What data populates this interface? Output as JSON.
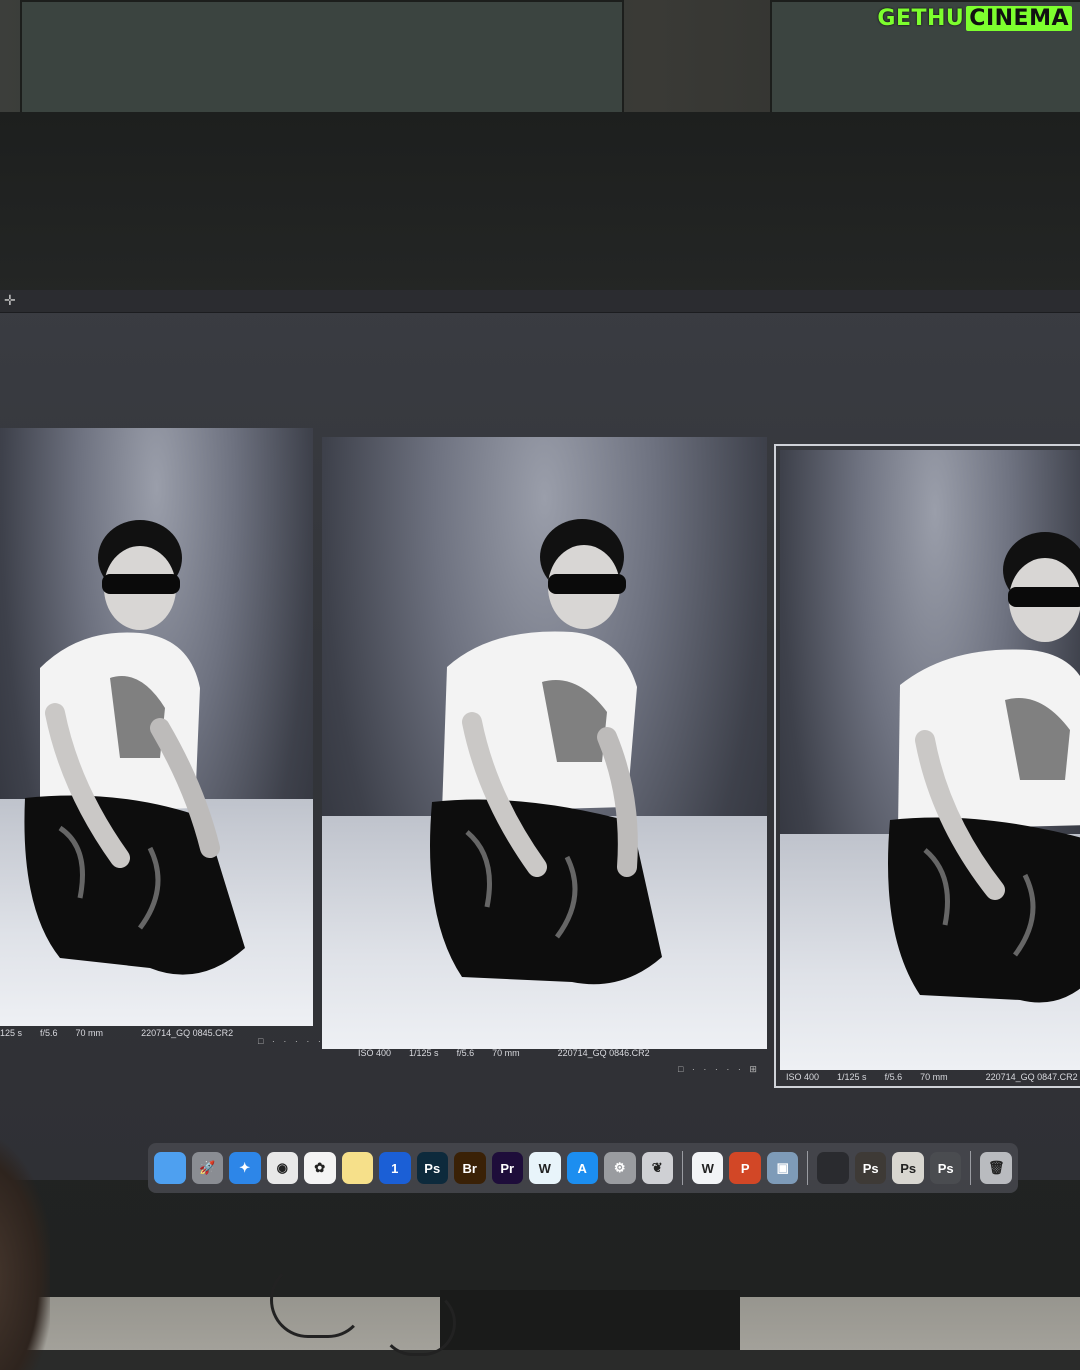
{
  "watermark": {
    "part1": "GETHU",
    "part2": "CINEMA"
  },
  "colors": {
    "watermark_green": "#7dff2e",
    "selected_frame": "#cfd2d8"
  },
  "toolbar": {
    "icon": "crosshair-icon"
  },
  "thumbnails": [
    {
      "iso": "",
      "shutter": "125 s",
      "aperture": "f/5.6",
      "focal": "70 mm",
      "filename": "220714_GQ 0845.CR2",
      "selected": false
    },
    {
      "iso": "ISO 400",
      "shutter": "1/125 s",
      "aperture": "f/5.6",
      "focal": "70 mm",
      "filename": "220714_GQ 0846.CR2",
      "selected": false
    },
    {
      "iso": "ISO 400",
      "shutter": "1/125 s",
      "aperture": "f/5.6",
      "focal": "70 mm",
      "filename": "220714_GQ 0847.CR2",
      "selected": true
    }
  ],
  "rating_dots": "□ · · · · · ⊞",
  "dock": {
    "items": [
      {
        "name": "finder-icon",
        "label": "",
        "bg": "#4ea0f0"
      },
      {
        "name": "launchpad-icon",
        "label": "🚀",
        "bg": "#8a8d93"
      },
      {
        "name": "safari-icon",
        "label": "✦",
        "bg": "#2d86e8"
      },
      {
        "name": "chrome-icon",
        "label": "◉",
        "bg": "#e8e8e8"
      },
      {
        "name": "photos-icon",
        "label": "✿",
        "bg": "#f4f4f4"
      },
      {
        "name": "notes-icon",
        "label": "",
        "bg": "#f6e08a"
      },
      {
        "name": "1password-icon",
        "label": "1",
        "bg": "#1b5fd6"
      },
      {
        "name": "photoshop-icon",
        "label": "Ps",
        "bg": "#0d2a3c"
      },
      {
        "name": "bridge-icon",
        "label": "Br",
        "bg": "#3a2106"
      },
      {
        "name": "premiere-icon",
        "label": "Pr",
        "bg": "#1e0d3a"
      },
      {
        "name": "wunderbucket-icon",
        "label": "W",
        "bg": "#e8f4fa"
      },
      {
        "name": "app-store-icon",
        "label": "A",
        "bg": "#1c8ef0"
      },
      {
        "name": "system-preferences-icon",
        "label": "⚙",
        "bg": "#9a9ca0"
      },
      {
        "name": "butterfly-icon",
        "label": "❦",
        "bg": "#cfd0d4"
      },
      {
        "name": "webex-icon",
        "label": "W",
        "bg": "#f2f4f6"
      },
      {
        "name": "powerpoint-icon",
        "label": "P",
        "bg": "#d24726"
      },
      {
        "name": "preview-icon",
        "label": "▣",
        "bg": "#7e9bb8"
      },
      {
        "name": "window-thumb-1-icon",
        "label": "",
        "bg": "#2a2b2f"
      },
      {
        "name": "window-thumb-2-icon",
        "label": "Ps",
        "bg": "#3e3a36"
      },
      {
        "name": "window-thumb-3-icon",
        "label": "Ps",
        "bg": "#d8d6d0"
      },
      {
        "name": "window-thumb-4-icon",
        "label": "Ps",
        "bg": "#4a4c50"
      },
      {
        "name": "trash-icon",
        "label": "🗑",
        "bg": "#b9bbbf"
      }
    ]
  }
}
